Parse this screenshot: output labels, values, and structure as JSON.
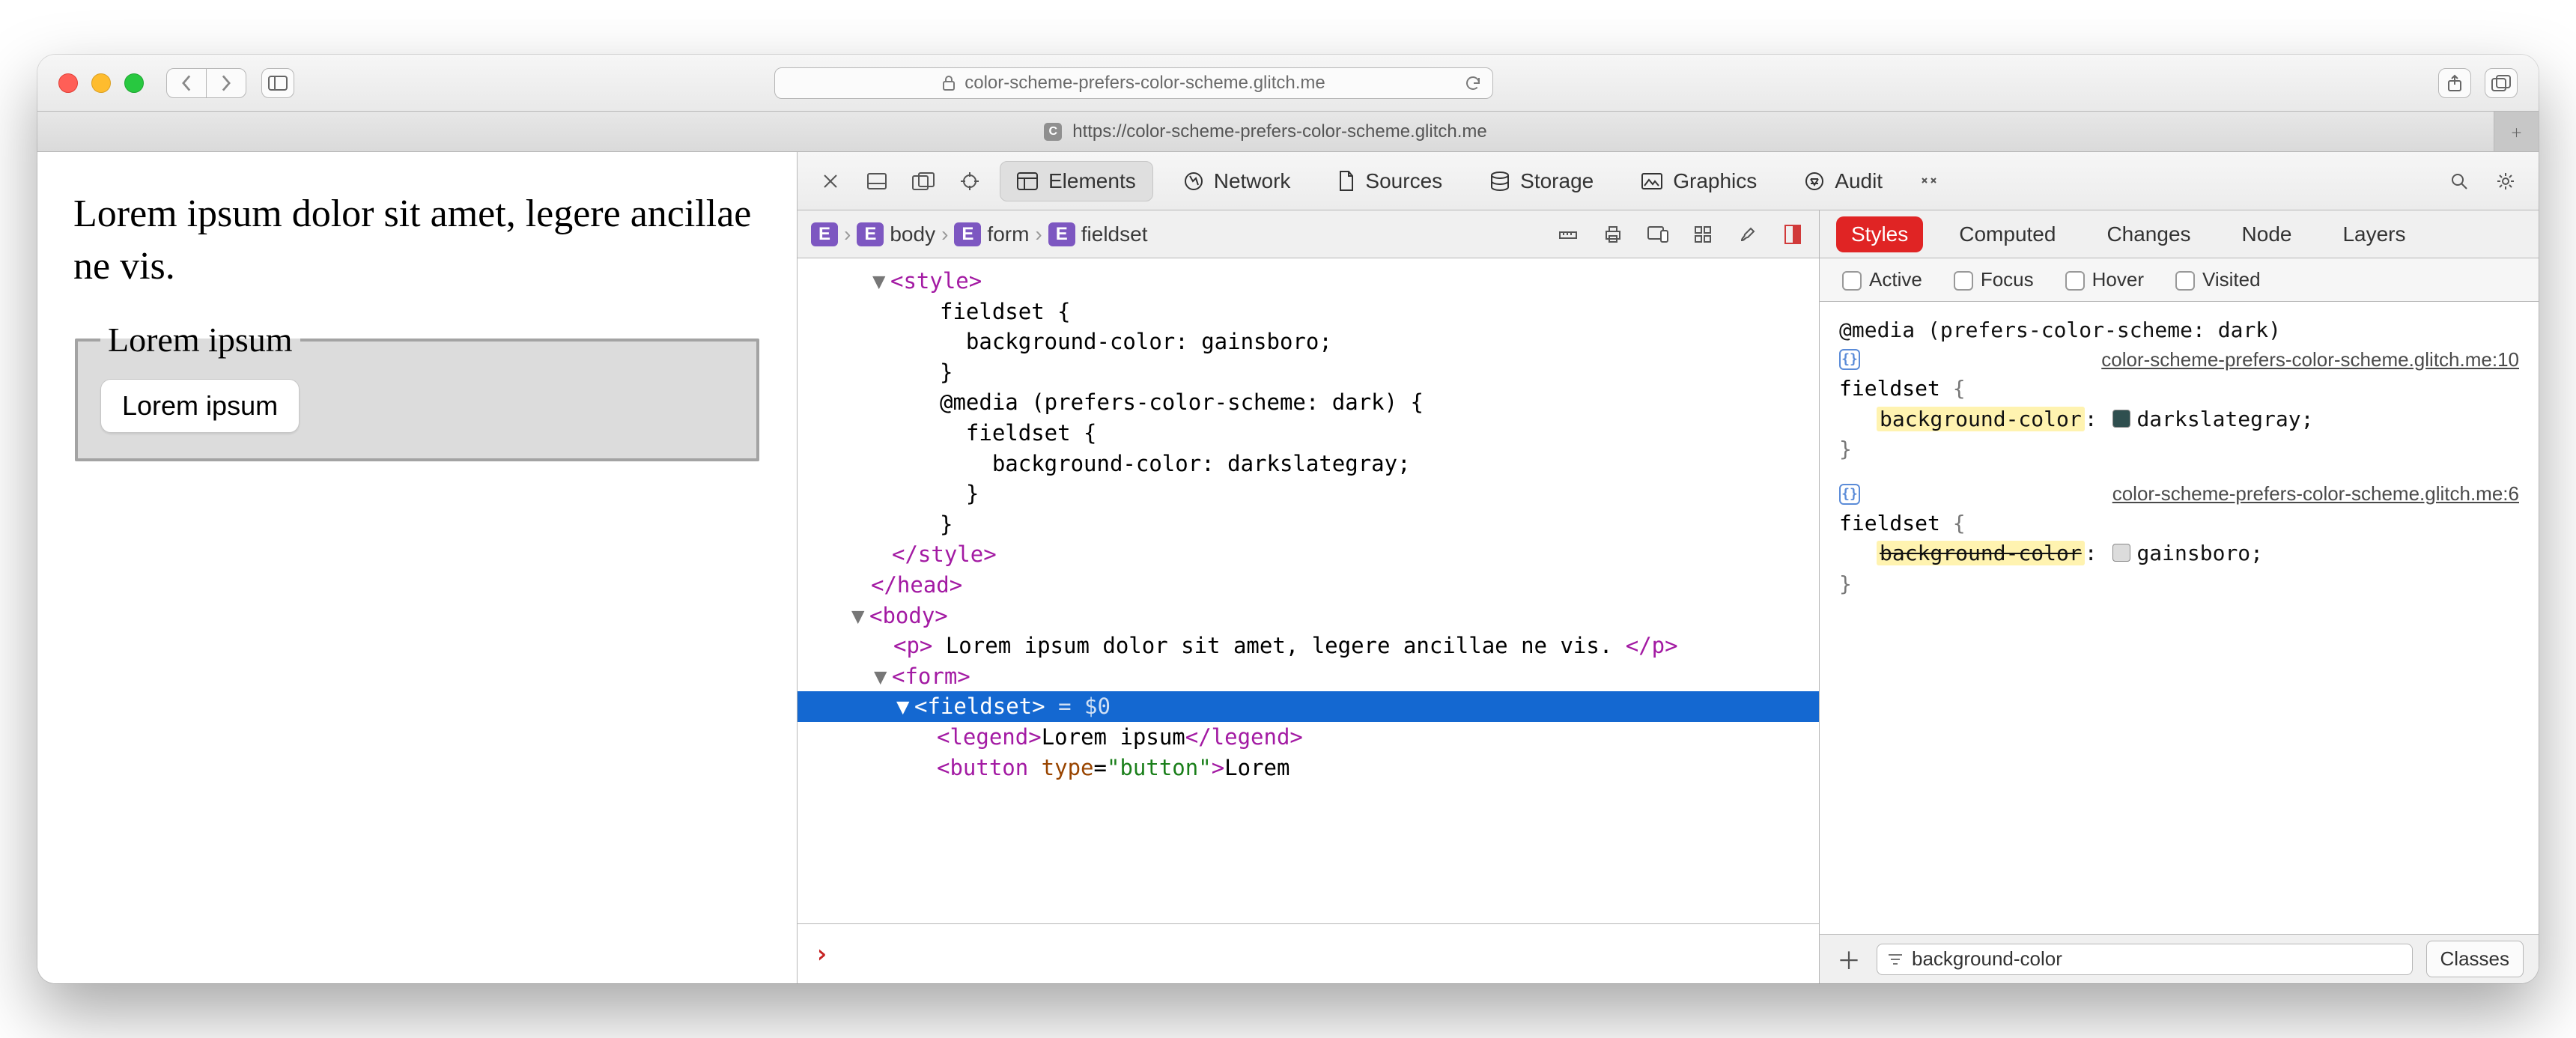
{
  "titlebar": {
    "url_host": "color-scheme-prefers-color-scheme.glitch.me"
  },
  "tab": {
    "favicon_letter": "C",
    "title": "https://color-scheme-prefers-color-scheme.glitch.me"
  },
  "devtools_tabs": {
    "elements": "Elements",
    "network": "Network",
    "sources": "Sources",
    "storage": "Storage",
    "graphics": "Graphics",
    "audit": "Audit"
  },
  "breadcrumbs": [
    "body",
    "form",
    "fieldset"
  ],
  "page": {
    "paragraph": "Lorem ipsum dolor sit amet, legere ancillae ne vis.",
    "legend": "Lorem ipsum",
    "button": "Lorem ipsum"
  },
  "dom_text": {
    "style_open": "<style>",
    "rule1a": "fieldset {",
    "rule1b": "  background-color: gainsboro;",
    "rule1c": "}",
    "media_open": "@media (prefers-color-scheme: dark) {",
    "rule2a": "  fieldset {",
    "rule2b": "    background-color: darkslategray;",
    "rule2c": "  }",
    "media_close": "}",
    "style_close": "</style>",
    "head_close": "</head>",
    "body_open": "<body>",
    "p_open": "<p>",
    "p_text": " Lorem ipsum dolor sit amet, legere ancillae ne vis. ",
    "p_close": "</p>",
    "form_open": "<form>",
    "fieldset_open": "<fieldset>",
    "eq0": " = $0",
    "legend_open": "<legend>",
    "legend_text": "Lorem ipsum",
    "legend_close": "</legend>",
    "button_open": "<button",
    "button_attr_name": " type",
    "button_attr_eq": "=",
    "button_attr_val": "\"button\"",
    "button_open_end": ">",
    "button_text": "Lorem"
  },
  "styles_tabs": {
    "styles": "Styles",
    "computed": "Computed",
    "changes": "Changes",
    "node": "Node",
    "layers": "Layers"
  },
  "pseudo": {
    "active": "Active",
    "focus": "Focus",
    "hover": "Hover",
    "visited": "Visited"
  },
  "rules": {
    "media": "@media (prefers-color-scheme: dark)",
    "src1": "color-scheme-prefers-color-scheme.glitch.me:10",
    "sel": "fieldset",
    "prop": "background-color",
    "val1": "darkslategray",
    "swatch1": "#2f4f4f",
    "src2": "color-scheme-prefers-color-scheme.glitch.me:6",
    "val2": "gainsboro",
    "swatch2": "#dcdcdc"
  },
  "filter": {
    "value": "background-color",
    "classes": "Classes"
  }
}
